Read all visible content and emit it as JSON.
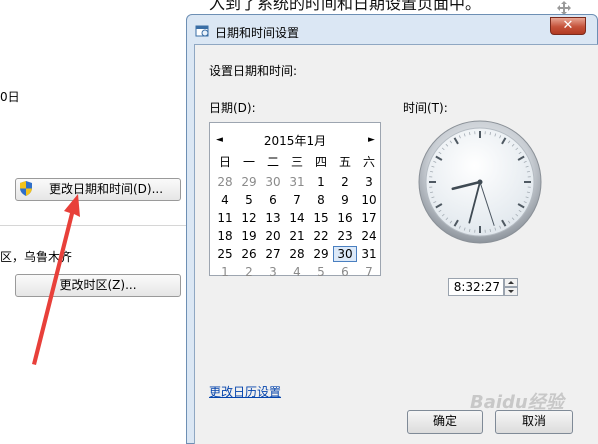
{
  "caption": "入到了系统的时间和日期设置页面中。",
  "background": {
    "partial_text_1": "0日",
    "change_datetime_button": "更改日期和时间(D)...",
    "timezone_text": "区，乌鲁木齐",
    "change_timezone_button": "更改时区(Z)..."
  },
  "dialog": {
    "title": "日期和时间设置",
    "close_label": "✕",
    "heading": "设置日期和时间:",
    "date_label": "日期(D):",
    "time_label": "时间(T):",
    "calendar": {
      "prev": "◄",
      "next": "►",
      "month": "2015年1月",
      "weekdays": [
        "日",
        "一",
        "二",
        "三",
        "四",
        "五",
        "六"
      ],
      "weeks": [
        [
          "28",
          "29",
          "30",
          "31",
          "1",
          "2",
          "3"
        ],
        [
          "4",
          "5",
          "6",
          "7",
          "8",
          "9",
          "10"
        ],
        [
          "11",
          "12",
          "13",
          "14",
          "15",
          "16",
          "17"
        ],
        [
          "18",
          "19",
          "20",
          "21",
          "22",
          "23",
          "24"
        ],
        [
          "25",
          "26",
          "27",
          "28",
          "29",
          "30",
          "31"
        ],
        [
          "1",
          "2",
          "3",
          "4",
          "5",
          "6",
          "7"
        ]
      ],
      "selected_day": "30"
    },
    "clock": {
      "hours": 8,
      "minutes": 32,
      "seconds": 27
    },
    "time_value": "8:32:27",
    "change_calendar_link": "更改日历设置",
    "ok_button": "确定",
    "cancel_button": "取消"
  },
  "watermark": "Baidu经验",
  "colors": {
    "arrow": "#e8403a",
    "link": "#0645ad",
    "close": "#c5523a"
  }
}
